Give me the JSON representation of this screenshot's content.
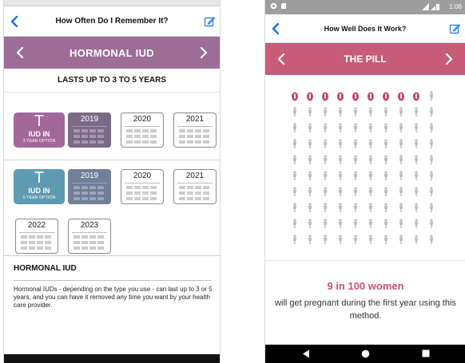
{
  "left_screen": {
    "header_title": "How Often Do I Remember It?",
    "band_title": "HORMONAL IUD",
    "lasts_text": "LASTS UP TO 3 TO 5 YEARS",
    "row1": {
      "badge_symbol": "T",
      "badge_label": "IUD IN",
      "badge_sub": "3 YEAR OPTION",
      "years": [
        "2019",
        "2020",
        "2021"
      ]
    },
    "row2": {
      "badge_symbol": "T",
      "badge_label": "IUD IN",
      "badge_sub": "5 YEAR OPTION",
      "years": [
        "2019",
        "2020",
        "2021",
        "2022",
        "2023"
      ]
    },
    "info_title": "HORMONAL IUD",
    "info_text": "Hormonal IUDs - depending on the type you use - can last up to 3 or 5 years, and you can have it removed any time you want by your health care provider.",
    "colors": {
      "band": "#9b6d98",
      "badge_3yr": "#a4679a",
      "badge_5yr": "#5e9bb3",
      "tile_filled_3yr": "#7a6a86",
      "tile_filled_5yr": "#6f7f99",
      "accent_blue": "#1a73e8"
    }
  },
  "right_screen": {
    "status_time": "1:06",
    "header_title": "How Well Does It Work?",
    "band_title": "THE PILL",
    "pregnant_count": 9,
    "total_women": 100,
    "result_headline": "9 in 100 women",
    "result_text": "will get pregnant during the first year using this method.",
    "colors": {
      "band": "#c85a7a",
      "highlight_figure": "#c2466f",
      "other_figure": "#bdbdbd",
      "headline": "#c84f78"
    }
  }
}
